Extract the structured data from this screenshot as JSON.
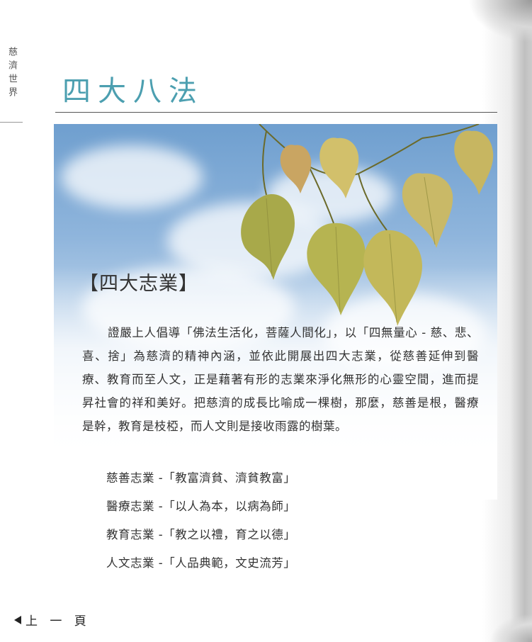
{
  "side_tab": {
    "label": "慈濟世界"
  },
  "page": {
    "title": "四大八法"
  },
  "section": {
    "title": "【四大志業】",
    "paragraph": "證嚴上人倡導「佛法生活化，菩薩人間化」，以「四無量心 - 慈、悲、喜、捨」為慈濟的精神內涵，並依此開展出四大志業，從慈善延伸到醫療、教育而至人文，正是藉著有形的志業來淨化無形的心靈空間，進而提昇社會的祥和美好。把慈濟的成長比喻成一棵樹，那麼，慈善是根，醫療是幹，教育是枝椏，而人文則是接收雨露的樹葉。",
    "items": [
      "慈善志業 -「教富濟貧、濟貧教富」",
      "醫療志業 -「以人為本，以病為師」",
      "教育志業 -「教之以禮，育之以德」",
      "人文志業 -「人品典範，文史流芳」"
    ]
  },
  "nav": {
    "prev_label": "上 一 頁"
  },
  "colors": {
    "title": "#4c9fb0",
    "text": "#333333",
    "sky": "#8fb5dc",
    "leaf": "#b9b24a"
  }
}
